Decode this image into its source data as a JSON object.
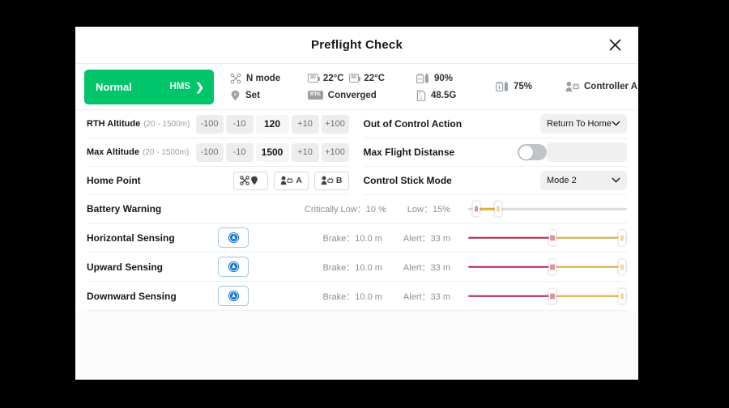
{
  "dialog": {
    "title": "Preflight Check",
    "close_icon": "close-icon"
  },
  "status": {
    "hms": {
      "state_label": "Normal",
      "link_label": "HMS",
      "chevron": "❯",
      "color": "#00c56a"
    },
    "groups": [
      {
        "name": "flight-mode",
        "rows": [
          {
            "icon": "drone-icon",
            "text": "N mode"
          },
          {
            "icon": "home-point-icon",
            "text": "Set"
          }
        ]
      },
      {
        "name": "temperature",
        "rows": [
          {
            "icon": "battery-temp-icon",
            "badge": "80",
            "text": "22°C",
            "icon2": "battery-temp-icon",
            "badge2": "80",
            "text2": "22°C"
          },
          {
            "icon": "rtk-icon",
            "badge": "RTK",
            "text": "Converged"
          }
        ]
      },
      {
        "name": "aircraft-battery",
        "rows": [
          {
            "icon": "aircraft-battery-icon",
            "text": "90%"
          },
          {
            "icon": "sd-card-icon",
            "text": "48.5G"
          }
        ]
      },
      {
        "name": "controller-battery",
        "rows": [
          {
            "icon": "controller-battery-icon",
            "text": "75%"
          }
        ]
      },
      {
        "name": "controller",
        "rows": [
          {
            "icon": "controller-icon",
            "text": "Controller A"
          }
        ]
      }
    ]
  },
  "settings": {
    "rth_altitude": {
      "label": "RTH Altitude",
      "range": "(20 - 1500m)",
      "minus_big": "-100",
      "minus_small": "-10",
      "value": "120",
      "plus_small": "+10",
      "plus_big": "+100"
    },
    "max_altitude": {
      "label": "Max Altitude",
      "range": "(20 - 1500m)",
      "minus_big": "-100",
      "minus_small": "-10",
      "value": "1500",
      "plus_small": "+10",
      "plus_big": "+100"
    },
    "home_point": {
      "label": "Home Point",
      "buttons": [
        {
          "name": "home-point-aircraft",
          "icon": "drone-pin-icon",
          "text": ""
        },
        {
          "name": "home-point-a",
          "icon": "controller-icon",
          "text": "A"
        },
        {
          "name": "home-point-b",
          "icon": "controller-icon",
          "text": "B"
        }
      ]
    },
    "out_of_control": {
      "label": "Out of Control Action",
      "value": "Return To Home",
      "chevron": "⌄"
    },
    "max_flight_distance": {
      "label": "Max Flight Distanse",
      "toggle_on": false,
      "field_value": ""
    },
    "control_stick_mode": {
      "label": "Control Stick Mode",
      "value": "Mode 2",
      "chevron": "⌄"
    },
    "battery_warning": {
      "label": "Battery Warning",
      "critically_low": "Critically Low：10 %",
      "low": "Low：15%",
      "slider": {
        "critical_pct": 5,
        "low_pct": 19
      }
    },
    "sensing": [
      {
        "label": "Horizontal Sensing",
        "icon": "obstacle-sensing-icon",
        "brake": "Brake：10.0 m",
        "alert": "Alert：33 m",
        "slider": {
          "brake_pct": 53,
          "alert_pct": 97
        }
      },
      {
        "label": "Upward Sensing",
        "icon": "obstacle-sensing-icon",
        "brake": "Brake：10.0 m",
        "alert": "Alert：33 m",
        "slider": {
          "brake_pct": 53,
          "alert_pct": 97
        }
      },
      {
        "label": "Downward Sensing",
        "icon": "obstacle-sensing-icon",
        "brake": "Brake：10.0 m",
        "alert": "Alert：33 m",
        "slider": {
          "brake_pct": 53,
          "alert_pct": 97
        }
      }
    ]
  }
}
